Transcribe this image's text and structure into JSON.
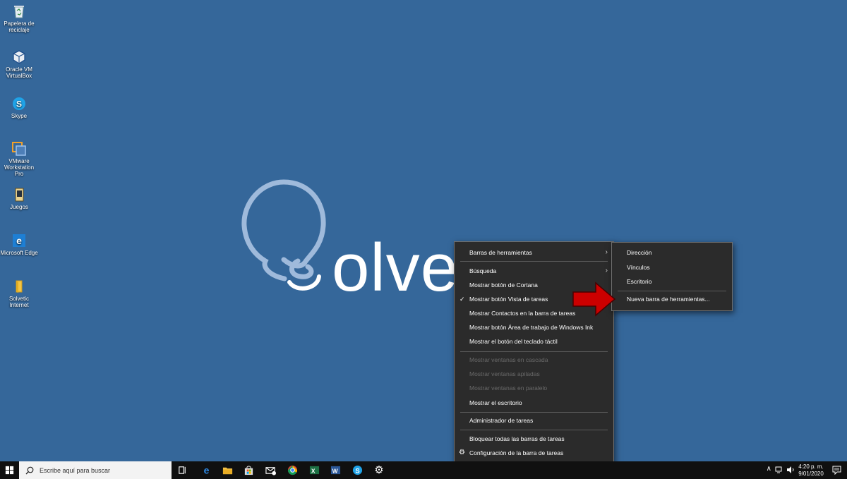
{
  "desktop": {
    "icons": [
      {
        "label": "Papelera de reciclaje",
        "icon": "recycle-bin-icon"
      },
      {
        "label": "Oracle VM VirtualBox",
        "icon": "virtualbox-icon"
      },
      {
        "label": "Skype",
        "icon": "skype-icon"
      },
      {
        "label": "VMware Workstation Pro",
        "icon": "vmware-icon"
      },
      {
        "label": "Juegos",
        "icon": "games-icon"
      },
      {
        "label": "Microsoft Edge",
        "icon": "edge-icon"
      },
      {
        "label": "Solvetic Internet",
        "icon": "folder-icon"
      }
    ],
    "logo_text": "olve"
  },
  "context_menu": {
    "items": [
      {
        "label": "Barras de herramientas",
        "submenu": true
      },
      {
        "label": "Búsqueda",
        "submenu": true
      },
      {
        "label": "Mostrar botón de Cortana"
      },
      {
        "label": "Mostrar botón Vista de tareas",
        "checked": true
      },
      {
        "label": "Mostrar Contactos en la barra de tareas"
      },
      {
        "label": "Mostrar botón Área de trabajo de Windows Ink"
      },
      {
        "label": "Mostrar el botón del teclado táctil"
      },
      {
        "label": "Mostrar ventanas en cascada",
        "disabled": true
      },
      {
        "label": "Mostrar ventanas apiladas",
        "disabled": true
      },
      {
        "label": "Mostrar ventanas en paralelo",
        "disabled": true
      },
      {
        "label": "Mostrar el escritorio"
      },
      {
        "label": "Administrador de tareas"
      },
      {
        "label": "Bloquear todas las barras de tareas"
      },
      {
        "label": "Configuración de la barra de tareas",
        "icon": "gear-icon"
      }
    ]
  },
  "submenu": {
    "items": [
      {
        "label": "Dirección"
      },
      {
        "label": "Vínculos"
      },
      {
        "label": "Escritorio"
      },
      {
        "label": "Nueva barra de herramientas..."
      }
    ]
  },
  "taskbar": {
    "search_placeholder": "Escribe aquí para buscar",
    "pinned": [
      "task-view-icon",
      "edge-icon",
      "file-explorer-icon",
      "store-icon",
      "mail-icon",
      "chrome-icon",
      "excel-icon",
      "word-icon",
      "skype-icon",
      "settings-icon"
    ],
    "clock_time": "4:20 p. m.",
    "clock_date": "9/01/2020"
  },
  "colors": {
    "desktop": "#35679a",
    "menu_bg": "#2b2b2b",
    "taskbar": "#101010",
    "accent_red": "#cc0000"
  }
}
